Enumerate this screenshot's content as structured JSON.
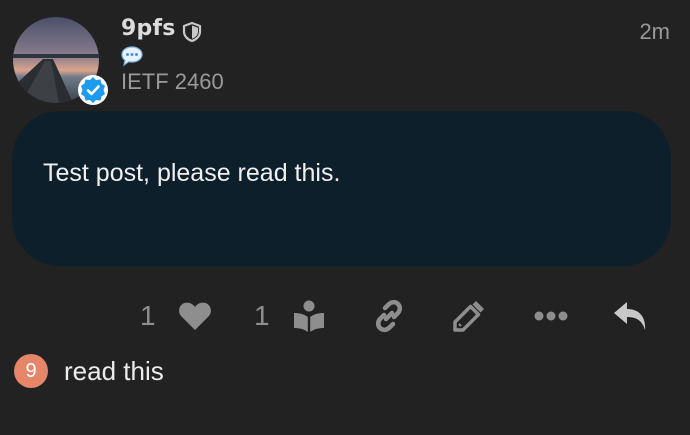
{
  "post": {
    "username": "9pfs",
    "group_flair": "IETF 2460",
    "timestamp": "2m",
    "body": "Test post, please read this."
  },
  "actions": {
    "like_count": "1",
    "read_count": "1"
  },
  "reply": {
    "avatar_letter": "9",
    "text": "read this"
  },
  "colors": {
    "background": "#222222",
    "bubble": "#0d1f2a",
    "verified_badge": "#1d9bf0",
    "reply_avatar": "#e5866a",
    "icon_gray": "#8e8e8e"
  },
  "icons": [
    "shield-icon",
    "speech-bubble-icon",
    "verified-check-icon",
    "heart-icon",
    "book-reader-icon",
    "link-icon",
    "pencil-icon",
    "more-icon",
    "reply-icon"
  ]
}
